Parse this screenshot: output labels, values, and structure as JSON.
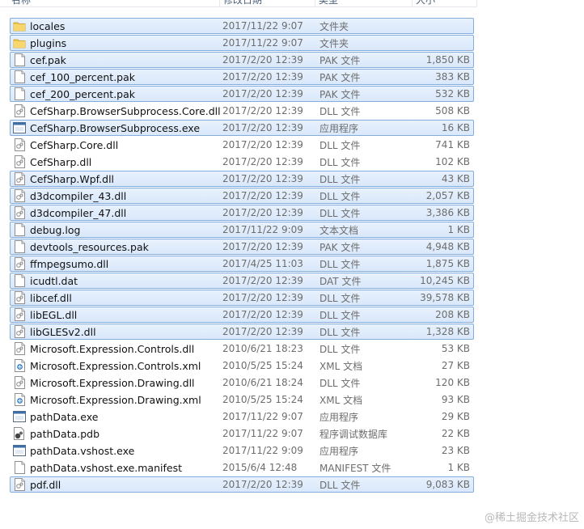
{
  "columns": {
    "name": "名称",
    "date": "修改日期",
    "type": "类型",
    "size": "大小"
  },
  "files": [
    {
      "name": "locales",
      "date": "2017/11/22 9:07",
      "type": "文件夹",
      "size": "",
      "icon": "folder-icon",
      "selected": true
    },
    {
      "name": "plugins",
      "date": "2017/11/22 9:07",
      "type": "文件夹",
      "size": "",
      "icon": "folder-icon",
      "selected": true
    },
    {
      "name": "cef.pak",
      "date": "2017/2/20 12:39",
      "type": "PAK 文件",
      "size": "1,850 KB",
      "icon": "file-icon",
      "selected": true
    },
    {
      "name": "cef_100_percent.pak",
      "date": "2017/2/20 12:39",
      "type": "PAK 文件",
      "size": "383 KB",
      "icon": "file-icon",
      "selected": true
    },
    {
      "name": "cef_200_percent.pak",
      "date": "2017/2/20 12:39",
      "type": "PAK 文件",
      "size": "532 KB",
      "icon": "file-icon",
      "selected": true
    },
    {
      "name": "CefSharp.BrowserSubprocess.Core.dll",
      "date": "2017/2/20 12:39",
      "type": "DLL 文件",
      "size": "508 KB",
      "icon": "dll-icon",
      "selected": false
    },
    {
      "name": "CefSharp.BrowserSubprocess.exe",
      "date": "2017/2/20 12:39",
      "type": "应用程序",
      "size": "16 KB",
      "icon": "exe-icon",
      "selected": true
    },
    {
      "name": "CefSharp.Core.dll",
      "date": "2017/2/20 12:39",
      "type": "DLL 文件",
      "size": "741 KB",
      "icon": "dll-icon",
      "selected": false
    },
    {
      "name": "CefSharp.dll",
      "date": "2017/2/20 12:39",
      "type": "DLL 文件",
      "size": "102 KB",
      "icon": "dll-icon",
      "selected": false
    },
    {
      "name": "CefSharp.Wpf.dll",
      "date": "2017/2/20 12:39",
      "type": "DLL 文件",
      "size": "43 KB",
      "icon": "dll-icon",
      "selected": true
    },
    {
      "name": "d3dcompiler_43.dll",
      "date": "2017/2/20 12:39",
      "type": "DLL 文件",
      "size": "2,057 KB",
      "icon": "dll-icon",
      "selected": true
    },
    {
      "name": "d3dcompiler_47.dll",
      "date": "2017/2/20 12:39",
      "type": "DLL 文件",
      "size": "3,386 KB",
      "icon": "dll-icon",
      "selected": true
    },
    {
      "name": "debug.log",
      "date": "2017/11/22 9:09",
      "type": "文本文档",
      "size": "1 KB",
      "icon": "file-icon",
      "selected": true
    },
    {
      "name": "devtools_resources.pak",
      "date": "2017/2/20 12:39",
      "type": "PAK 文件",
      "size": "4,948 KB",
      "icon": "file-icon",
      "selected": true
    },
    {
      "name": "ffmpegsumo.dll",
      "date": "2017/4/25 11:03",
      "type": "DLL 文件",
      "size": "1,875 KB",
      "icon": "dll-icon",
      "selected": true
    },
    {
      "name": "icudtl.dat",
      "date": "2017/2/20 12:39",
      "type": "DAT 文件",
      "size": "10,245 KB",
      "icon": "file-icon",
      "selected": true
    },
    {
      "name": "libcef.dll",
      "date": "2017/2/20 12:39",
      "type": "DLL 文件",
      "size": "39,578 KB",
      "icon": "dll-icon",
      "selected": true
    },
    {
      "name": "libEGL.dll",
      "date": "2017/2/20 12:39",
      "type": "DLL 文件",
      "size": "208 KB",
      "icon": "dll-icon",
      "selected": true
    },
    {
      "name": "libGLESv2.dll",
      "date": "2017/2/20 12:39",
      "type": "DLL 文件",
      "size": "1,328 KB",
      "icon": "dll-icon",
      "selected": true
    },
    {
      "name": "Microsoft.Expression.Controls.dll",
      "date": "2010/6/21 18:23",
      "type": "DLL 文件",
      "size": "53 KB",
      "icon": "dll-icon",
      "selected": false
    },
    {
      "name": "Microsoft.Expression.Controls.xml",
      "date": "2010/5/25 15:24",
      "type": "XML 文档",
      "size": "27 KB",
      "icon": "xml-icon",
      "selected": false
    },
    {
      "name": "Microsoft.Expression.Drawing.dll",
      "date": "2010/6/21 18:24",
      "type": "DLL 文件",
      "size": "120 KB",
      "icon": "dll-icon",
      "selected": false
    },
    {
      "name": "Microsoft.Expression.Drawing.xml",
      "date": "2010/5/25 15:24",
      "type": "XML 文档",
      "size": "93 KB",
      "icon": "xml-icon",
      "selected": false
    },
    {
      "name": "pathData.exe",
      "date": "2017/11/22 9:07",
      "type": "应用程序",
      "size": "29 KB",
      "icon": "exe-icon",
      "selected": false
    },
    {
      "name": "pathData.pdb",
      "date": "2017/11/22 9:07",
      "type": "程序调试数据库",
      "size": "22 KB",
      "icon": "pdb-icon",
      "selected": false
    },
    {
      "name": "pathData.vshost.exe",
      "date": "2017/11/22 9:09",
      "type": "应用程序",
      "size": "23 KB",
      "icon": "exe-icon",
      "selected": false
    },
    {
      "name": "pathData.vshost.exe.manifest",
      "date": "2015/6/4 12:48",
      "type": "MANIFEST 文件",
      "size": "1 KB",
      "icon": "file-icon",
      "selected": false
    },
    {
      "name": "pdf.dll",
      "date": "2017/2/20 12:39",
      "type": "DLL 文件",
      "size": "9,083 KB",
      "icon": "dll-icon",
      "selected": true
    }
  ],
  "watermark": "@稀土掘金技术社区"
}
